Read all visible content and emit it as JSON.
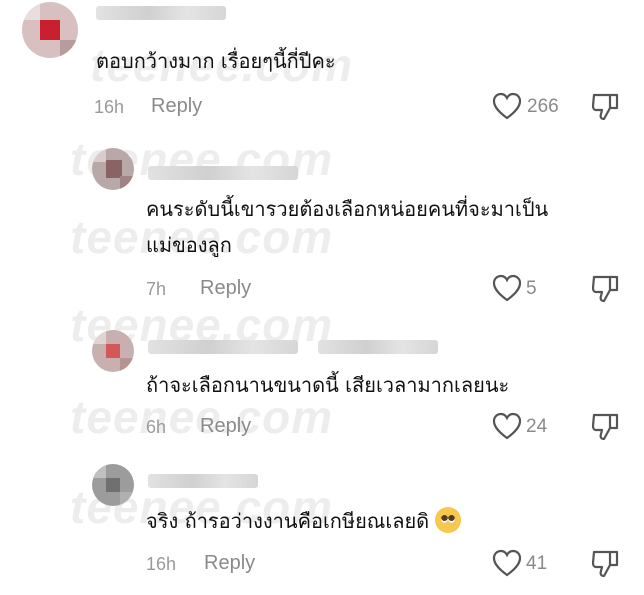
{
  "watermark": "teenee.com",
  "comments": [
    {
      "text": "ตอบกว้างมาก เรื่อยๆนี้กี่ปีคะ",
      "time": "16h",
      "reply": "Reply",
      "likes": "266"
    },
    {
      "text_line1": "คนระดับนี้เขารวยต้องเลือกหน่อยคนที่จะมาเป็น",
      "text_line2": "แม่ของลูก",
      "time": "7h",
      "reply": "Reply",
      "likes": "5"
    },
    {
      "text": "ถ้าจะเลือกนานขนาดนี้ เสียเวลามากเลยนะ",
      "time": "6h",
      "reply": "Reply",
      "likes": "24"
    },
    {
      "text": "จริง ถ้ารอว่างงานคือเกษียณเลยดิ",
      "emoji": "pleading-face-emoji",
      "time": "16h",
      "reply": "Reply",
      "likes": "41"
    }
  ],
  "colors": {
    "text": "#111111",
    "meta": "#8a8a8a",
    "icon": "#555555"
  }
}
